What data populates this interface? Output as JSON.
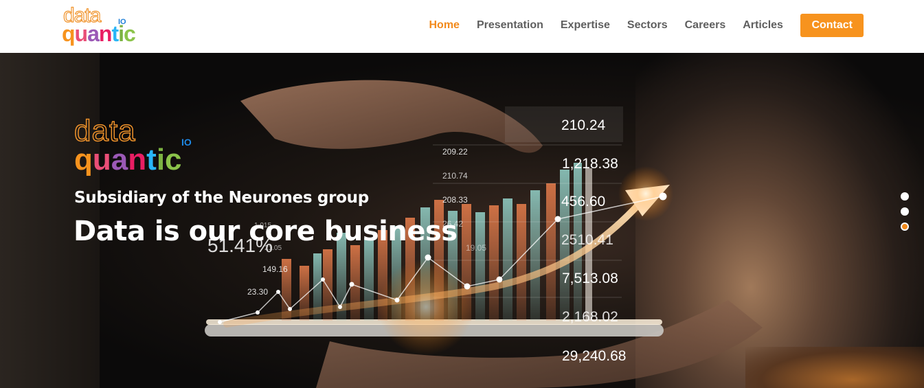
{
  "brand": {
    "logo_data": "data",
    "logo_quantic_letters": [
      {
        "ch": "q",
        "color": "#f7931e"
      },
      {
        "ch": "u",
        "color": "#e94e77"
      },
      {
        "ch": "a",
        "color": "#9b59b6"
      },
      {
        "ch": "n",
        "color": "#e91e63"
      },
      {
        "ch": "t",
        "color": "#29b6f6"
      },
      {
        "ch": "i",
        "color": "#7cb342"
      },
      {
        "ch": "c",
        "color": "#8bc34a"
      }
    ],
    "logo_io": "IO"
  },
  "nav": {
    "items": [
      {
        "label": "Home",
        "active": true
      },
      {
        "label": "Presentation",
        "active": false
      },
      {
        "label": "Expertise",
        "active": false
      },
      {
        "label": "Sectors",
        "active": false
      },
      {
        "label": "Careers",
        "active": false
      },
      {
        "label": "Articles",
        "active": false
      }
    ],
    "contact_label": "Contact"
  },
  "hero": {
    "subtitle": "Subsidiary of the Neurones group",
    "title": "Data is our core business",
    "slides_total": 3,
    "active_slide": 3,
    "figures": [
      "210.24",
      "1,218.38",
      "456.60",
      "2510.41",
      "7,513.08",
      "2,168.02",
      "29,240.68",
      "209.22",
      "210.74",
      "208.33",
      "26.42",
      "51.41%",
      "149.16",
      "23.30",
      "19.05",
      "1.015",
      "21.05"
    ]
  },
  "colors": {
    "accent": "#f28a1c",
    "nav_text": "#5f5f5f",
    "contact_bg": "#f7931e"
  }
}
